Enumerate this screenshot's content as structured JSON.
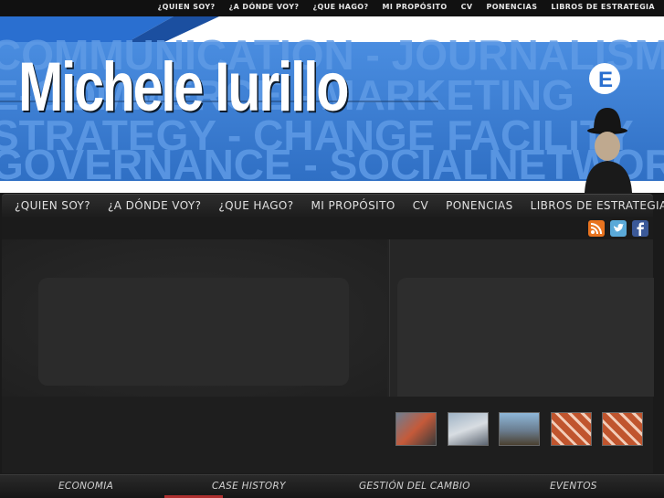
{
  "top_nav": {
    "items": [
      "¿QUIEN SOY?",
      "¿A DÓNDE VOY?",
      "¿QUE HAGO?",
      "MI PROPÓSITO",
      "CV",
      "PONENCIAS",
      "LIBROS DE ESTRATEGIA"
    ]
  },
  "header": {
    "title": "Michele Iurillo",
    "logo_letter": "E",
    "background_words": [
      "COMMUNICATION - JOURNALISM",
      "E-COMMERCE - MARKETING",
      "STRATEGY - CHANGE FACILITY",
      "GOVERNANCE - SOCIALNETWORK"
    ]
  },
  "main_nav": {
    "items": [
      "¿QUIEN SOY?",
      "¿A DÓNDE VOY?",
      "¿QUE HAGO?",
      "MI PROPÓSITO",
      "CV",
      "PONENCIAS",
      "LIBROS DE ESTRATEGIA"
    ]
  },
  "social": {
    "icons": [
      "rss-icon",
      "twitter-icon",
      "facebook-icon"
    ],
    "colors": {
      "rss": "#e8731f",
      "twitter": "#5aa9d8",
      "facebook": "#3b5998"
    }
  },
  "bottom_nav": {
    "items": [
      "ECONOMIA",
      "CASE HISTORY",
      "GESTIÓN DEL CAMBIO",
      "EVENTOS"
    ]
  },
  "colors": {
    "accent_blue": "#3d7fd1",
    "dark_bg": "#1a1a1a"
  }
}
